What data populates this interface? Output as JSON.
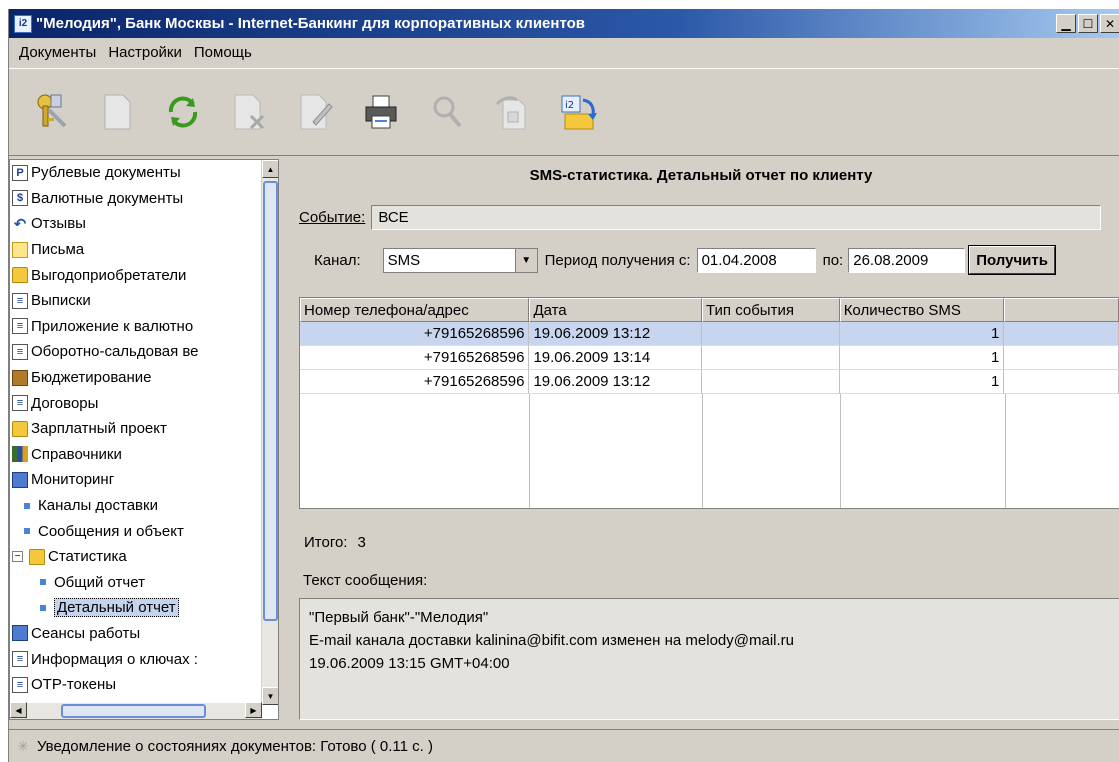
{
  "window": {
    "title": "\"Мелодия\", Банк Москвы - Internet-Банкинг для корпоративных клиентов",
    "app_icon": "i2"
  },
  "menu": [
    "Документы",
    "Настройки",
    "Помощь"
  ],
  "toolbar": {
    "icons": [
      "keys-icon",
      "document-icon",
      "refresh-icon",
      "delete-document-icon",
      "edit-document-icon",
      "print-icon",
      "search-icon",
      "export-icon",
      "import-icon"
    ]
  },
  "tree": {
    "items": [
      {
        "label": "Рублевые документы",
        "icon": "doc",
        "glyph": "P"
      },
      {
        "label": "Валютные документы",
        "icon": "doc",
        "glyph": "$"
      },
      {
        "label": "Отзывы",
        "icon": "arrow",
        "glyph": "↶"
      },
      {
        "label": "Письма",
        "icon": "mail",
        "glyph": ""
      },
      {
        "label": "Выгодоприобретатели",
        "icon": "folder",
        "glyph": ""
      },
      {
        "label": "Выписки",
        "icon": "doc",
        "glyph": "≡"
      },
      {
        "label": "Приложение к валютно",
        "icon": "doc",
        "glyph": "≡"
      },
      {
        "label": "Оборотно-сальдовая ве",
        "icon": "doc",
        "glyph": "≡"
      },
      {
        "label": "Бюджетирование",
        "icon": "brief",
        "glyph": ""
      },
      {
        "label": "Договоры",
        "icon": "doc",
        "glyph": "≡"
      },
      {
        "label": "Зарплатный проект",
        "icon": "folder",
        "glyph": ""
      },
      {
        "label": "Справочники",
        "icon": "books",
        "glyph": ""
      },
      {
        "label": "Мониторинг",
        "icon": "monitor",
        "glyph": ""
      },
      {
        "label": "Каналы доставки",
        "icon": "bullet",
        "level": 1
      },
      {
        "label": "Сообщения и объект",
        "icon": "bullet",
        "level": 1
      },
      {
        "label": "Статистика",
        "icon": "folder-open",
        "expander": "−"
      },
      {
        "label": "Общий отчет",
        "icon": "bullet",
        "level": 2
      },
      {
        "label": "Детальный отчет",
        "icon": "bullet",
        "level": 2,
        "selected": true
      },
      {
        "label": "Сеансы работы",
        "icon": "monitor",
        "glyph": ""
      },
      {
        "label": "Информация о ключах :",
        "icon": "doc",
        "glyph": "≡"
      },
      {
        "label": "OTP-токены",
        "icon": "doc",
        "glyph": "≡"
      }
    ]
  },
  "report": {
    "title": "SMS-статистика. Детальный отчет по клиенту",
    "event_label": "Событие:",
    "event_value": "ВСЕ",
    "channel_label": "Канал:",
    "channel_value": "SMS",
    "period_label": "Период получения с:",
    "date_from": "01.04.2008",
    "to_label": "по:",
    "date_to": "26.08.2009",
    "get_button": "Получить",
    "columns": [
      "Номер телефона/адрес",
      "Дата",
      "Тип события",
      "Количество SMS",
      ""
    ],
    "rows": [
      {
        "phone": "+79165268596",
        "date": "19.06.2009 13:12",
        "type": "",
        "count": "1",
        "selected": true
      },
      {
        "phone": "+79165268596",
        "date": "19.06.2009 13:14",
        "type": "",
        "count": "1"
      },
      {
        "phone": "+79165268596",
        "date": "19.06.2009 13:12",
        "type": "",
        "count": "1"
      }
    ],
    "total_label": "Итого:",
    "total_value": "3",
    "message_label": "Текст сообщения:",
    "message_lines": [
      "\"Первый банк\"-\"Мелодия\"",
      "E-mail канала доставки kalinina@bifit.com изменен на melody@mail.ru",
      "19.06.2009 13:15 GMT+04:00"
    ]
  },
  "status": {
    "text": "Уведомление о состояниях документов: Готово ( 0.11 с. )"
  },
  "colors": {
    "titlebar": "#0a246a",
    "selection": "#c7d5ee",
    "face": "#d4d0c8"
  }
}
